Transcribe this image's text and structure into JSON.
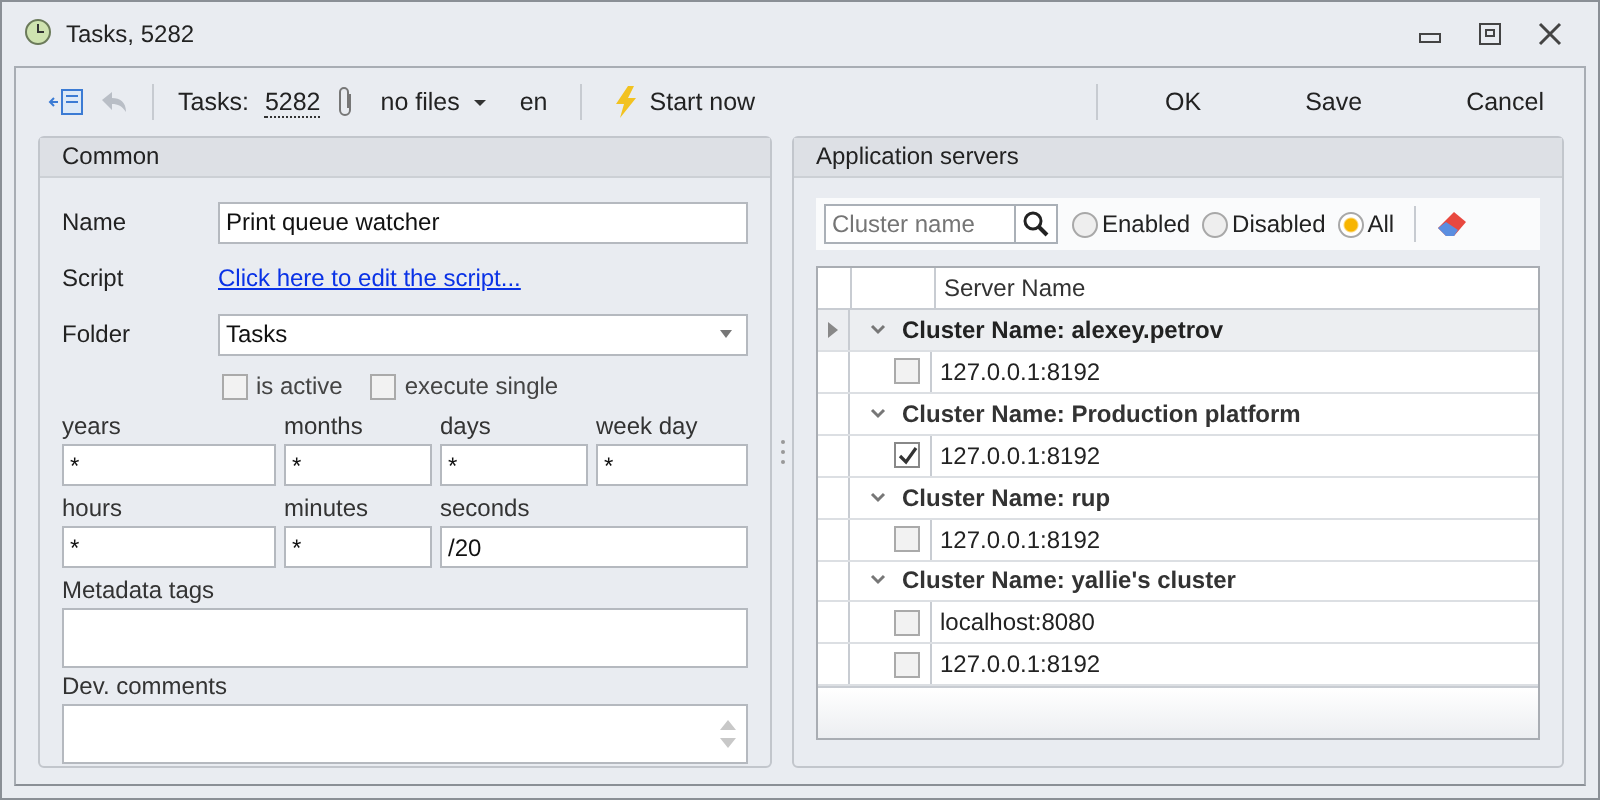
{
  "window": {
    "title": "Tasks, 5282"
  },
  "toolbar": {
    "tasks_label": "Tasks:",
    "tasks_count": "5282",
    "files": "no files",
    "language": "en",
    "start": "Start now",
    "buttons": [
      "OK",
      "Save",
      "Cancel"
    ]
  },
  "common": {
    "title": "Common",
    "name": {
      "label": "Name",
      "value": "Print queue watcher"
    },
    "script": {
      "label": "Script",
      "link": "Click here to edit the script..."
    },
    "folder": {
      "label": "Folder",
      "value": "Tasks"
    },
    "checkboxes": [
      {
        "label": "is active",
        "checked": false
      },
      {
        "label": "execute single",
        "checked": false
      }
    ],
    "schedule": [
      {
        "label": "years",
        "value": "*"
      },
      {
        "label": "months",
        "value": "*"
      },
      {
        "label": "days",
        "value": "*"
      },
      {
        "label": "week day",
        "value": "*"
      },
      {
        "label": "hours",
        "value": "*"
      },
      {
        "label": "minutes",
        "value": "*"
      },
      {
        "label": "seconds",
        "value": "/20"
      }
    ],
    "metadata": {
      "label": "Metadata tags"
    },
    "comments": {
      "label": "Dev. comments"
    }
  },
  "servers": {
    "title": "Application servers",
    "search": {
      "placeholder": "Cluster name"
    },
    "filters": [
      {
        "label": "Enabled",
        "selected": false
      },
      {
        "label": "Disabled",
        "selected": false
      },
      {
        "label": "All",
        "selected": true
      }
    ],
    "column": "Server Name",
    "groups": [
      {
        "title": "Cluster Name: alexey.petrov",
        "selected": true,
        "servers": [
          {
            "address": "127.0.0.1:8192",
            "checked": false
          }
        ]
      },
      {
        "title": "Cluster Name: Production platform",
        "selected": false,
        "servers": [
          {
            "address": "127.0.0.1:8192",
            "checked": true
          }
        ]
      },
      {
        "title": "Cluster Name: rup",
        "selected": false,
        "servers": [
          {
            "address": "127.0.0.1:8192",
            "checked": false
          }
        ]
      },
      {
        "title": "Cluster Name: yallie's cluster",
        "selected": false,
        "servers": [
          {
            "address": "localhost:8080",
            "checked": false
          },
          {
            "address": "127.0.0.1:8192",
            "checked": false
          }
        ]
      }
    ]
  }
}
